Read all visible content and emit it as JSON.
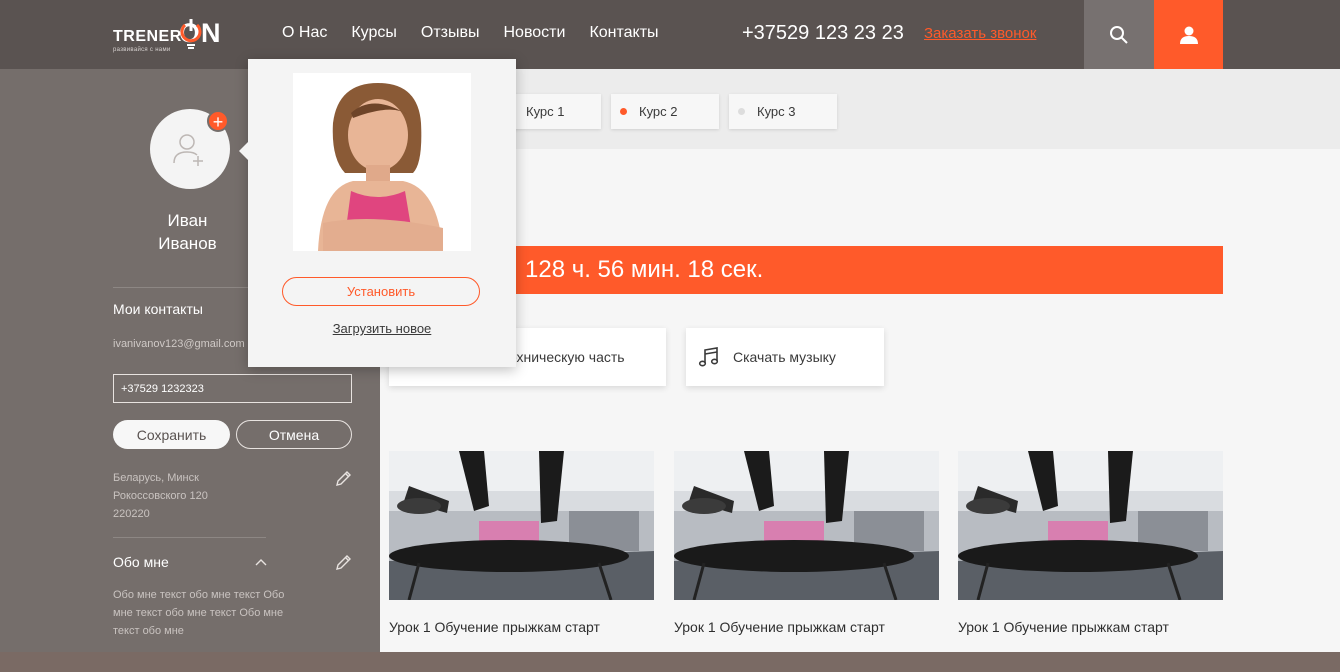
{
  "header": {
    "logo": {
      "main": "TRENER",
      "on": "ON",
      "tagline": "развивайся с нами"
    },
    "nav": [
      {
        "label": "О Нас"
      },
      {
        "label": "Курсы"
      },
      {
        "label": "Отзывы"
      },
      {
        "label": "Новости"
      },
      {
        "label": "Контакты"
      }
    ],
    "phone": "+37529 123 23 23",
    "callback": "Заказать звонок",
    "icons": {
      "search": "search-icon",
      "user": "user-icon"
    }
  },
  "sidebar": {
    "name_first": "Иван",
    "name_last": "Иванов",
    "contacts_title": "Мои контакты",
    "email": "ivanivanov123@gmail.com",
    "phone_value": "+37529 1232323",
    "save_label": "Сохранить",
    "cancel_label": "Отмена",
    "address_lines": [
      "Беларусь, Минск",
      "Рокоссовского 120",
      "220220"
    ],
    "about_title": "Обо мне",
    "about_text": "Обо мне текст обо мне текст Обо мне текст обо мне текст Обо мне текст обо мне"
  },
  "popup": {
    "set_label": "Установить",
    "upload_label": "Загрузить новое"
  },
  "main": {
    "tabs": [
      {
        "label": "Курс 1",
        "color": "#ffffff"
      },
      {
        "label": "Курс 2",
        "color": "#ff5a2a"
      },
      {
        "label": "Курс 3",
        "color": "#dddddd"
      }
    ],
    "timer": "128 ч. 56 мин. 18 сек.",
    "actions": {
      "tech_label": "ехническую часть",
      "music_label": "Скачать музыку"
    },
    "videos": [
      {
        "title": "Урок 1 Обучение прыжкам старт"
      },
      {
        "title": "Урок 1 Обучение прыжкам старт"
      },
      {
        "title": "Урок 1 Обучение прыжкам старт"
      }
    ]
  },
  "colors": {
    "accent": "#ff5a2a",
    "header": "#5a5351",
    "sidebar": "#756e6b"
  }
}
